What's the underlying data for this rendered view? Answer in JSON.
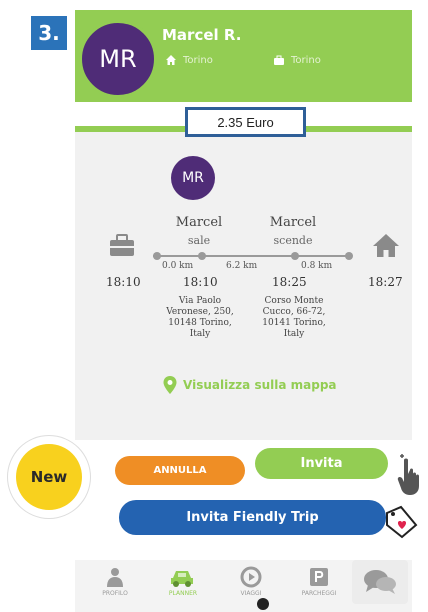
{
  "step": {
    "label": "3."
  },
  "driver": {
    "initials": "MR",
    "name": "Marcel R.",
    "home_city": "Torino",
    "work_city": "Torino"
  },
  "trip": {
    "price": "2.35 Euro",
    "passenger_initials": "MR",
    "pickup": {
      "person": "Marcel",
      "action": "sale",
      "time": "18:10",
      "address": [
        "Via Paolo",
        "Veronese, 250,",
        "10148 Torino,",
        "Italy"
      ]
    },
    "dropoff": {
      "person": "Marcel",
      "action": "scende",
      "time": "18:25",
      "address": [
        "Corso Monte",
        "Cucco, 66-72,",
        "10141 Torino,",
        "Italy"
      ]
    },
    "distances": [
      "0.0 km",
      "6.2 km",
      "0.8 km"
    ],
    "start_time": "18:10",
    "end_time": "18:27",
    "map_link": "Visualizza sulla mappa"
  },
  "actions": {
    "cancel": "ANNULLA",
    "invite": "Invita",
    "invite_friendly": "Invita Fiendly Trip"
  },
  "badge": {
    "new": "New"
  },
  "nav": {
    "items": [
      {
        "label": "PROFILO",
        "icon": "person-icon"
      },
      {
        "label": "PLANNER",
        "icon": "car-icon"
      },
      {
        "label": "VIAGGI",
        "icon": "play-icon"
      },
      {
        "label": "PARCHEGGI",
        "icon": "parking-icon"
      }
    ],
    "chat_icon": "chat-icon"
  },
  "colors": {
    "accent_green": "#93cd53",
    "purple": "#4f2c77",
    "blue": "#2463b1",
    "orange": "#ef8e25",
    "yellow": "#f8d11e"
  }
}
